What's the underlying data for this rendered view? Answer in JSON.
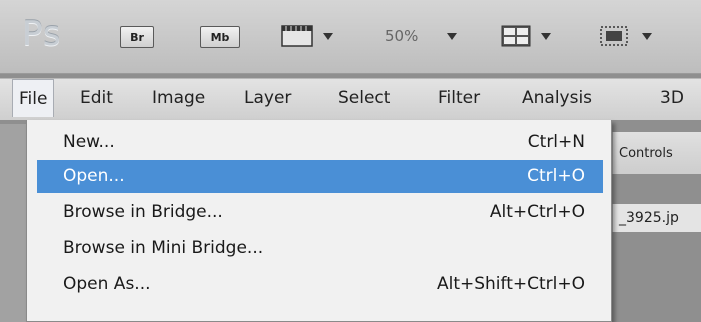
{
  "app": {
    "logo": "Ps"
  },
  "toolbar": {
    "bridge_label": "Br",
    "mini_bridge_label": "Mb",
    "zoom": "50%"
  },
  "menu_bar": {
    "items": [
      {
        "label": "File",
        "active": true
      },
      {
        "label": "Edit"
      },
      {
        "label": "Image"
      },
      {
        "label": "Layer"
      },
      {
        "label": "Select"
      },
      {
        "label": "Filter"
      },
      {
        "label": "Analysis"
      },
      {
        "label": "3D"
      }
    ]
  },
  "file_menu": {
    "items": [
      {
        "label": "New...",
        "shortcut": "Ctrl+N"
      },
      {
        "label": "Open...",
        "shortcut": "Ctrl+O",
        "highlighted": true
      },
      {
        "label": "Browse in Bridge...",
        "shortcut": "Alt+Ctrl+O"
      },
      {
        "label": "Browse in Mini Bridge...",
        "shortcut": ""
      },
      {
        "label": "Open As...",
        "shortcut": "Alt+Shift+Ctrl+O"
      }
    ]
  },
  "panel": {
    "label": "Controls"
  },
  "document": {
    "tab_label": "_3925.jp"
  },
  "colors": {
    "highlight": "#4a8fd6",
    "menu_bg": "#f1f1f1"
  }
}
